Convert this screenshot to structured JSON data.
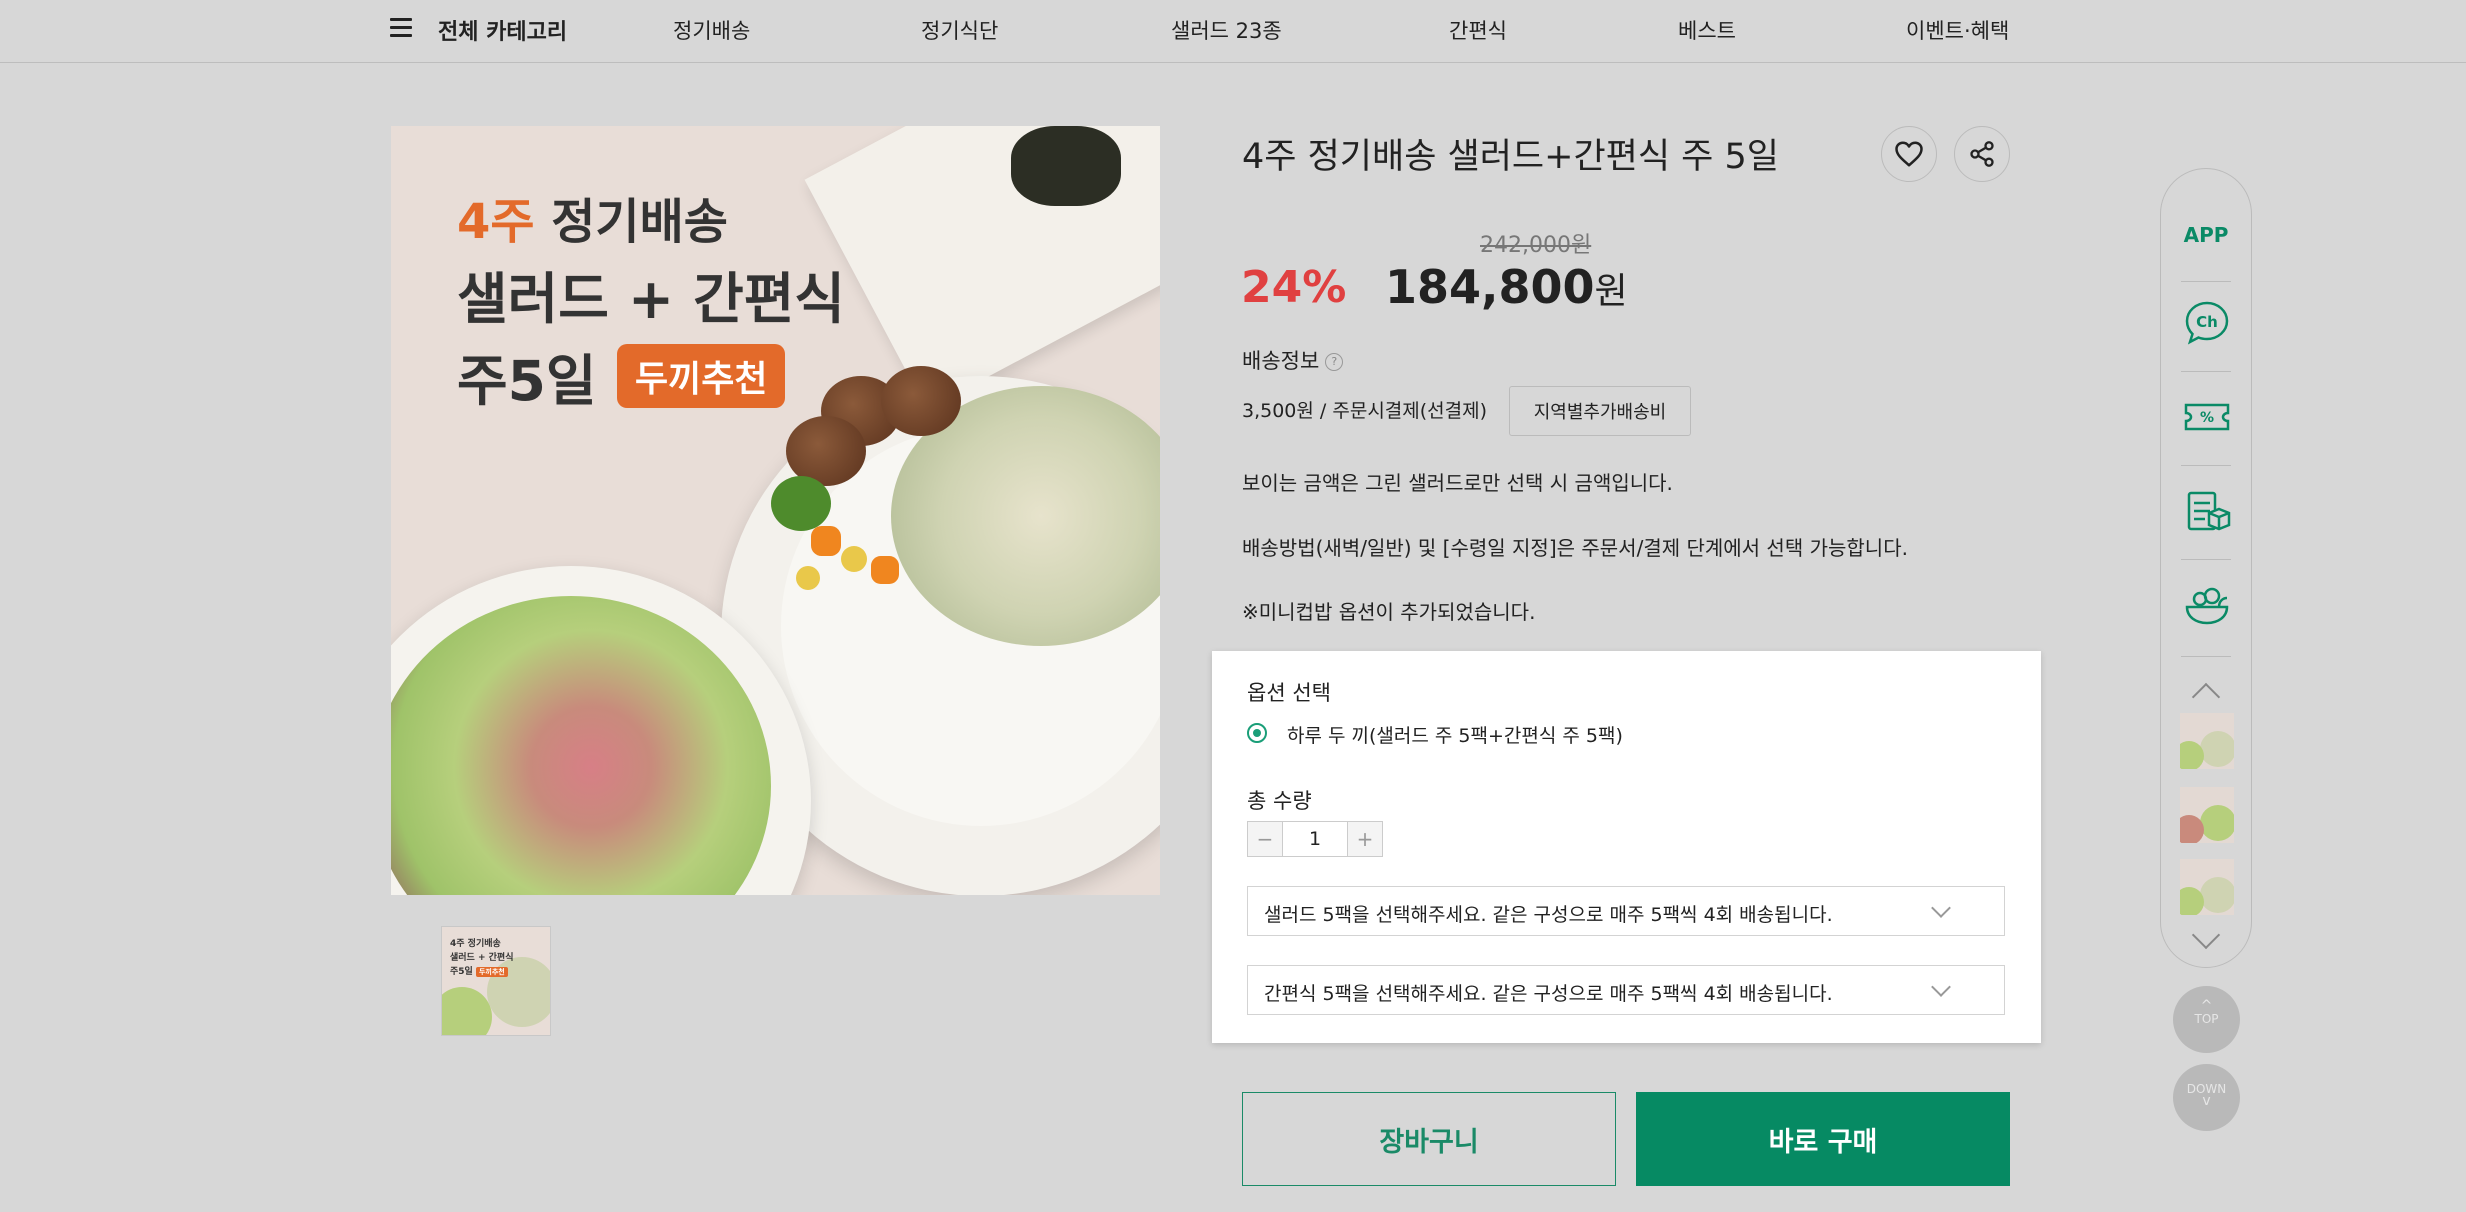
{
  "header": {
    "category_all": "전체 카테고리",
    "nav": [
      "정기배송",
      "정기식단",
      "샐러드 23종",
      "간편식",
      "베스트",
      "이벤트·혜택"
    ]
  },
  "hero_image": {
    "line1_accent": "4주",
    "line1_rest": " 정기배송",
    "line2": "샐러드 + 간편식",
    "line3": "주5일",
    "badge": "두끼추천"
  },
  "thumbnail": {
    "line1": "4주 정기배송",
    "line2": "샐러드 + 간편식",
    "line3": "주5일",
    "badge": "두끼추천"
  },
  "product": {
    "title": "4주 정기배송 샐러드+간편식 주 5일",
    "original_price": "242,000원",
    "discount": "24%",
    "price": "184,800",
    "price_unit": "원"
  },
  "shipping": {
    "label": "배송정보",
    "help": "?",
    "fee": "3,500원",
    "method": " / 주문시결제(선결제)",
    "region_button": "지역별추가배송비"
  },
  "notices": [
    "보이는 금액은 그린 샐러드로만 선택 시 금액입니다.",
    "배송방법(새벽/일반) 및 [수령일 지정]은 주문서/결제 단계에서 선택 가능합니다.",
    "※미니컵밥 옵션이 추가되었습니다."
  ],
  "options": {
    "title": "옵션 선택",
    "radio_label": "하루 두 끼(샐러드 주 5팩+간편식 주 5팩)",
    "qty_title": "총 수량",
    "qty_minus": "−",
    "qty_value": "1",
    "qty_plus": "+",
    "select1": "샐러드 5팩을 선택해주세요. 같은 구성으로 매주 5팩씩 4회 배송됩니다.",
    "select2": "간편식 5팩을 선택해주세요. 같은 구성으로 매주 5팩씩 4회 배송됩니다."
  },
  "actions": {
    "cart": "장바구니",
    "buy": "바로 구매"
  },
  "rail": {
    "app": "APP",
    "chat": "Ch",
    "top": "TOP",
    "down": "DOWN"
  },
  "colors": {
    "accent_green": "#068a63",
    "discount_red": "#e04040",
    "image_orange": "#e36a2a"
  }
}
